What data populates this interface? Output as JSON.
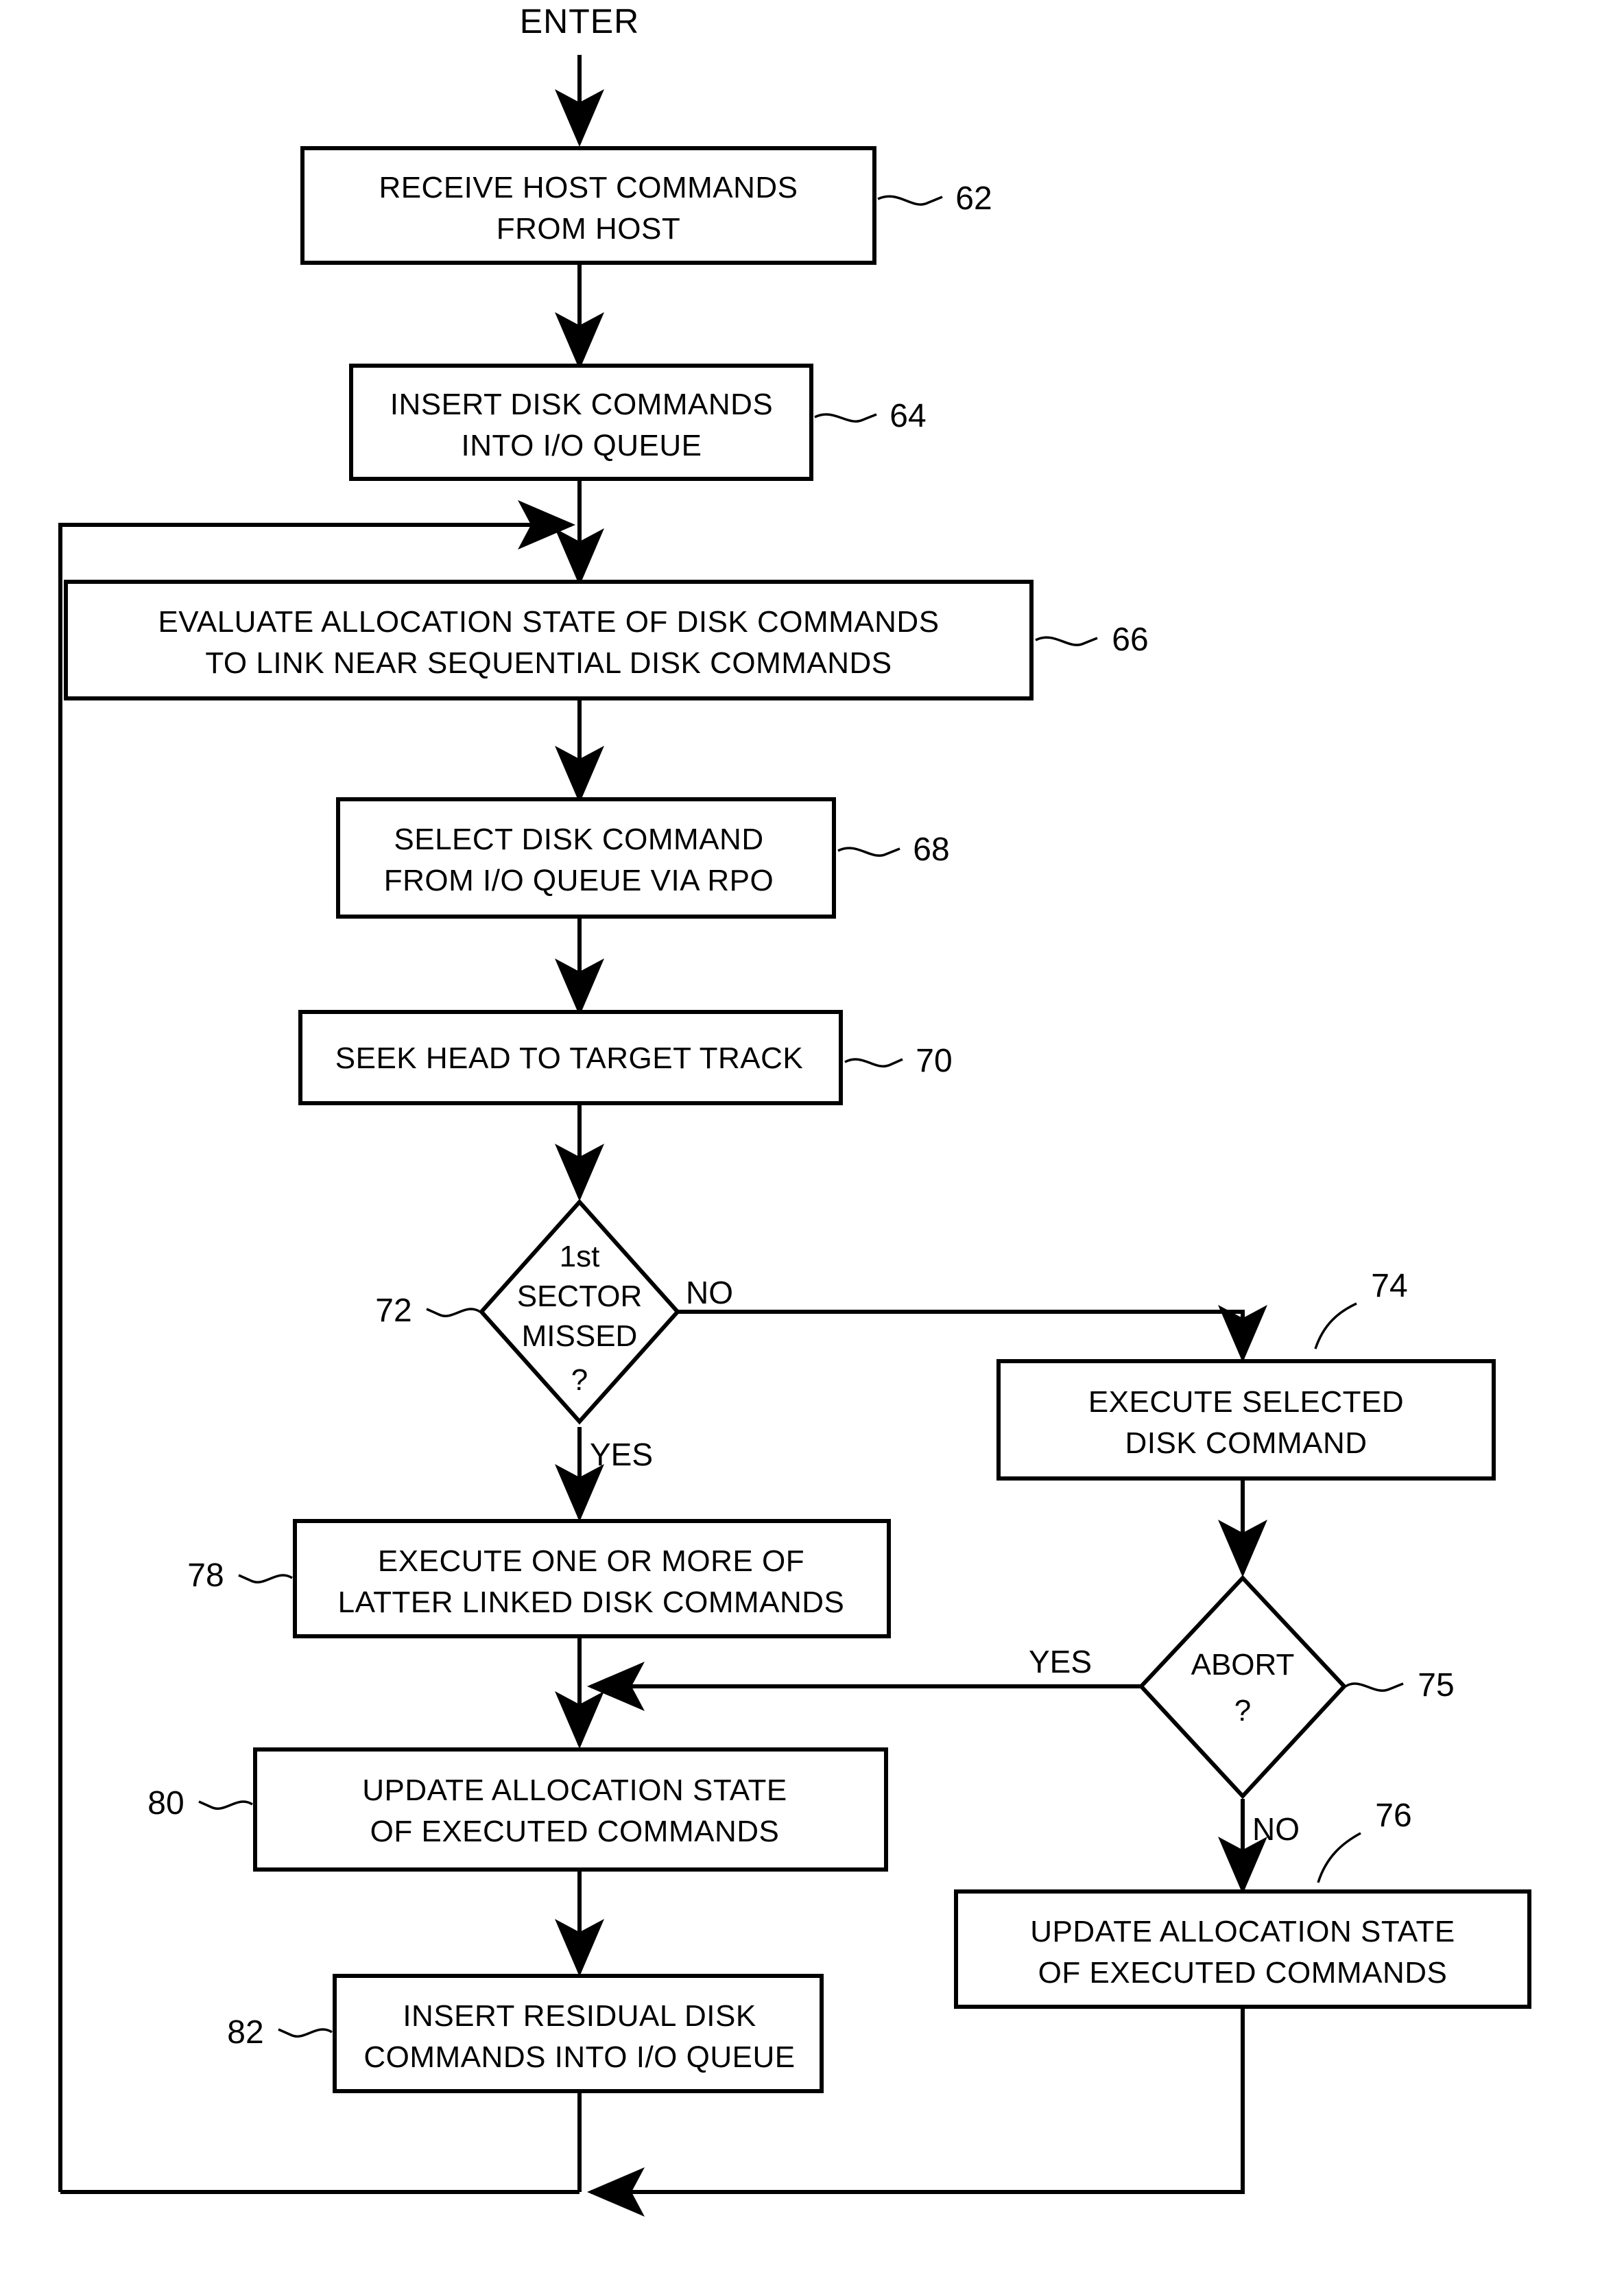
{
  "diagram": {
    "type": "flowchart",
    "entry_label": "ENTER",
    "nodes": [
      {
        "id": "n62",
        "ref": "62",
        "shape": "process",
        "lines": [
          "RECEIVE HOST COMMANDS",
          "FROM HOST"
        ]
      },
      {
        "id": "n64",
        "ref": "64",
        "shape": "process",
        "lines": [
          "INSERT DISK COMMANDS",
          "INTO I/O QUEUE"
        ]
      },
      {
        "id": "n66",
        "ref": "66",
        "shape": "process",
        "lines": [
          "EVALUATE ALLOCATION STATE OF DISK COMMANDS",
          "TO LINK NEAR SEQUENTIAL DISK COMMANDS"
        ]
      },
      {
        "id": "n68",
        "ref": "68",
        "shape": "process",
        "lines": [
          "SELECT DISK COMMAND",
          "FROM I/O QUEUE VIA RPO"
        ]
      },
      {
        "id": "n70",
        "ref": "70",
        "shape": "process",
        "lines": [
          "SEEK HEAD TO TARGET TRACK"
        ]
      },
      {
        "id": "n72",
        "ref": "72",
        "shape": "decision",
        "lines": [
          "1st",
          "SECTOR",
          "MISSED",
          "?"
        ]
      },
      {
        "id": "n74",
        "ref": "74",
        "shape": "process",
        "lines": [
          "EXECUTE SELECTED",
          "DISK COMMAND"
        ]
      },
      {
        "id": "n75",
        "ref": "75",
        "shape": "decision",
        "lines": [
          "ABORT",
          "?"
        ]
      },
      {
        "id": "n76",
        "ref": "76",
        "shape": "process",
        "lines": [
          "UPDATE ALLOCATION STATE",
          "OF EXECUTED COMMANDS"
        ]
      },
      {
        "id": "n78",
        "ref": "78",
        "shape": "process",
        "lines": [
          "EXECUTE ONE OR MORE OF",
          "LATTER LINKED DISK COMMANDS"
        ]
      },
      {
        "id": "n80",
        "ref": "80",
        "shape": "process",
        "lines": [
          "UPDATE ALLOCATION STATE",
          "OF EXECUTED COMMANDS"
        ]
      },
      {
        "id": "n82",
        "ref": "82",
        "shape": "process",
        "lines": [
          "INSERT RESIDUAL DISK",
          "COMMANDS INTO I/O QUEUE"
        ]
      }
    ],
    "edge_labels": {
      "d72_no": "NO",
      "d72_yes": "YES",
      "d75_yes": "YES",
      "d75_no": "NO"
    },
    "colors": {
      "stroke": "#000000",
      "fill": "#ffffff",
      "text": "#000000"
    }
  }
}
